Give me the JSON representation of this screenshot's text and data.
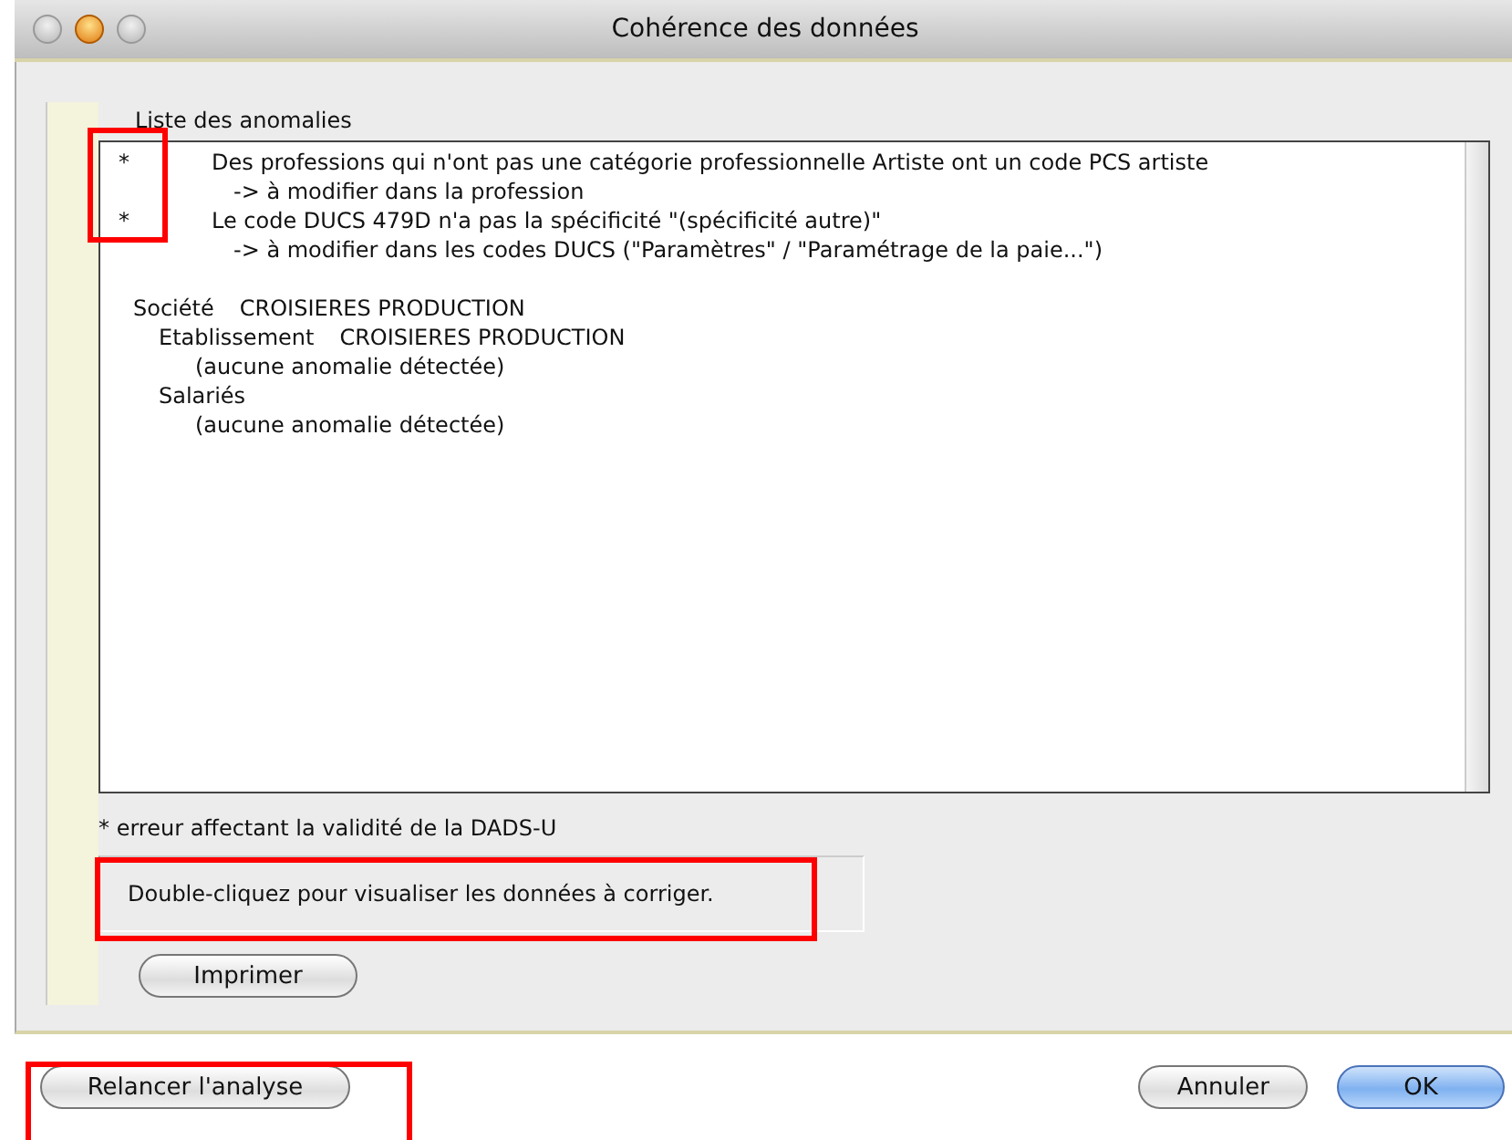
{
  "window": {
    "title": "Cohérence des données"
  },
  "list": {
    "title": "Liste des anomalies",
    "anomalies": [
      {
        "marker": "*",
        "text": "Des professions qui n'ont pas une catégorie professionnelle Artiste ont un code PCS artiste",
        "hint": "-> à modifier dans la profession"
      },
      {
        "marker": "*",
        "text": "Le code DUCS 479D n'a pas la spécificité \"(spécificité autre)\"",
        "hint": "-> à modifier dans les codes DUCS (\"Paramètres\" / \"Paramétrage de la paie...\")"
      }
    ],
    "tree": [
      {
        "label": "Société",
        "value": "CROISIERES PRODUCTION",
        "children": [
          {
            "label": "Etablissement",
            "value": "CROISIERES PRODUCTION",
            "children": [
              {
                "label": "(aucune anomalie détectée)"
              }
            ]
          },
          {
            "label": "Salariés",
            "children": [
              {
                "label": "(aucune anomalie détectée)"
              }
            ]
          }
        ]
      }
    ]
  },
  "footnote": "* erreur affectant la validité de la DADS-U",
  "info": "Double-cliquez pour visualiser les données à corriger.",
  "print_button": "Imprimer",
  "buttons": [
    {
      "label": "Relancer l'analyse",
      "kind": "plain"
    },
    {
      "label": "Annuler",
      "kind": "plain"
    },
    {
      "label": "OK",
      "kind": "default"
    }
  ]
}
